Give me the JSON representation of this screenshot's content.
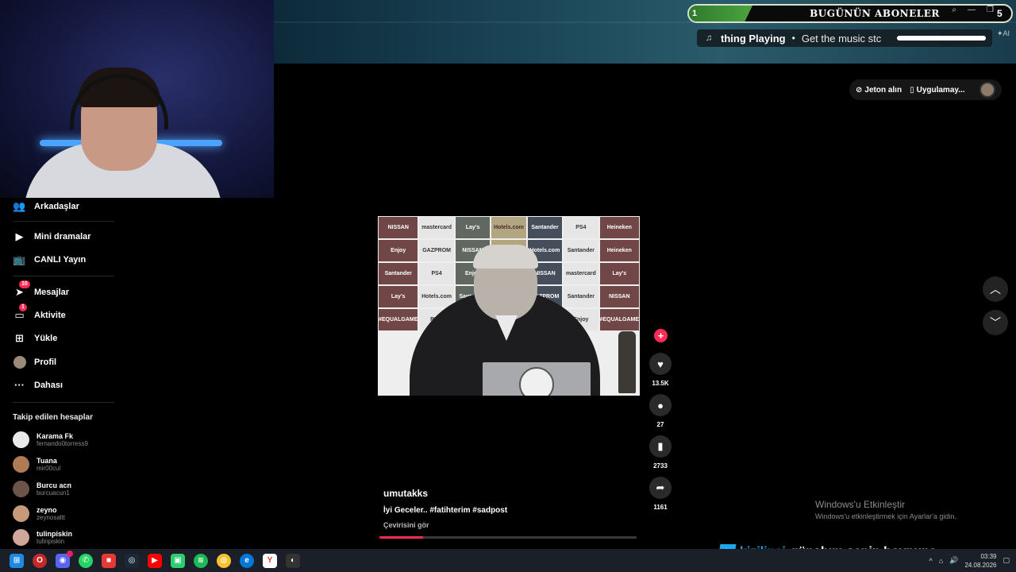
{
  "overlay": {
    "sub_count_left": "1",
    "sub_title": "BUGÜNÜN ABONELER",
    "sub_count_right": "5",
    "now_playing_title": "thing Playing",
    "now_playing_dot": "•",
    "now_playing_sub": "Get the music stc",
    "ai_tag": "✦AI",
    "song_artist": "kizilinci",
    "song_title": "günahım senin boynuna"
  },
  "sidebar": {
    "items": [
      {
        "label": "Arkadaşlar",
        "icon": "friends-icon"
      },
      {
        "label": "Mini dramalar",
        "icon": "play-square-icon"
      },
      {
        "label": "CANLI Yayın",
        "icon": "live-tv-icon"
      },
      {
        "label": "Mesajlar",
        "icon": "paper-plane-icon",
        "badge": "10"
      },
      {
        "label": "Aktivite",
        "icon": "inbox-icon",
        "badge": "1"
      },
      {
        "label": "Yükle",
        "icon": "plus-square-icon"
      },
      {
        "label": "Profil",
        "icon": "avatar-icon"
      },
      {
        "label": "Dahası",
        "icon": "more-icon"
      }
    ],
    "following_header": "Takip edilen hesaplar",
    "following": [
      {
        "name": "Karama Fk",
        "handle": "fernando0torress9"
      },
      {
        "name": "Tuana",
        "handle": "mir00cul"
      },
      {
        "name": "Burcu acn",
        "handle": "burcuacun1"
      },
      {
        "name": "zeyno",
        "handle": "zeynosaltt"
      },
      {
        "name": "tulinpiskin",
        "handle": "tulinpiskin"
      }
    ]
  },
  "header": {
    "coins_label": "Jeton alın",
    "app_label": "Uygulamay..."
  },
  "video": {
    "username": "umutakks",
    "caption": "İyi Geceler.. #fatihterim #sadpost",
    "translation": "Çevirisini gör",
    "progress": 0.17,
    "sponsors": [
      "NISSAN",
      "mastercard",
      "Lay's",
      "Hotels.com",
      "Santander",
      "PS4",
      "Heineken",
      "Enjoy",
      "GAZPROM",
      "NISSAN",
      "Lay's",
      "Hotels.com",
      "Santander",
      "Heineken",
      "Santander",
      "PS4",
      "Enjoy",
      "Heineken",
      "NISSAN",
      "mastercard",
      "Lay's",
      "Lay's",
      "Hotels.com",
      "Santander",
      "mastercard",
      "GAZPROM",
      "Santander",
      "NISSAN",
      "#EQUALGAME",
      "RMC",
      "PS4",
      "Heineken",
      "UEFA.com",
      "Enjoy",
      "#EQUALGAME"
    ]
  },
  "actions": {
    "likes": "13.5K",
    "comments": "27",
    "saves": "2733",
    "shares": "1161"
  },
  "windows": {
    "activate_title": "Windows'u Etkinleştir",
    "activate_sub": "Windows'u etkinleştirmek için Ayarlar'a gidin.",
    "time": "03:39",
    "date": "24.08.2026"
  },
  "colors": {
    "accent": "#fe2c55",
    "song_artist": "#1ea7e8",
    "taskbar": "#1b1f27"
  }
}
